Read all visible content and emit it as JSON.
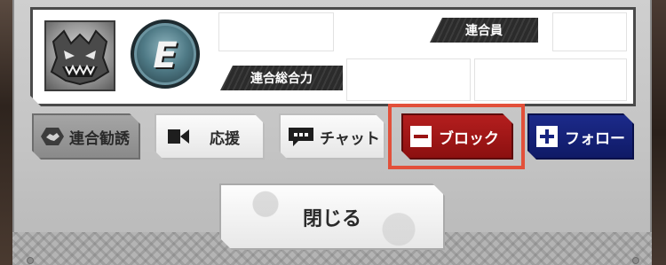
{
  "profile": {
    "rank_letter": "E",
    "member_label": "連合員",
    "member_value": "",
    "total_power_label": "連合総合力",
    "total_power_value": ""
  },
  "actions": {
    "invite_label": "連合勧誘",
    "cheer_label": "応援",
    "chat_label": "チャット",
    "block_label": "ブロック",
    "follow_label": "フォロー"
  },
  "footer": {
    "close_label": "閉じる"
  },
  "colors": {
    "block_button": "#9a1414",
    "follow_button": "#172480",
    "highlight_frame": "#e2503a"
  },
  "icons": {
    "emblem": "demon-face-emblem-icon",
    "invite": "handshake-icon",
    "cheer": "video-camera-icon",
    "chat": "speech-bubble-icon",
    "block": "minus-icon",
    "follow": "plus-icon"
  }
}
